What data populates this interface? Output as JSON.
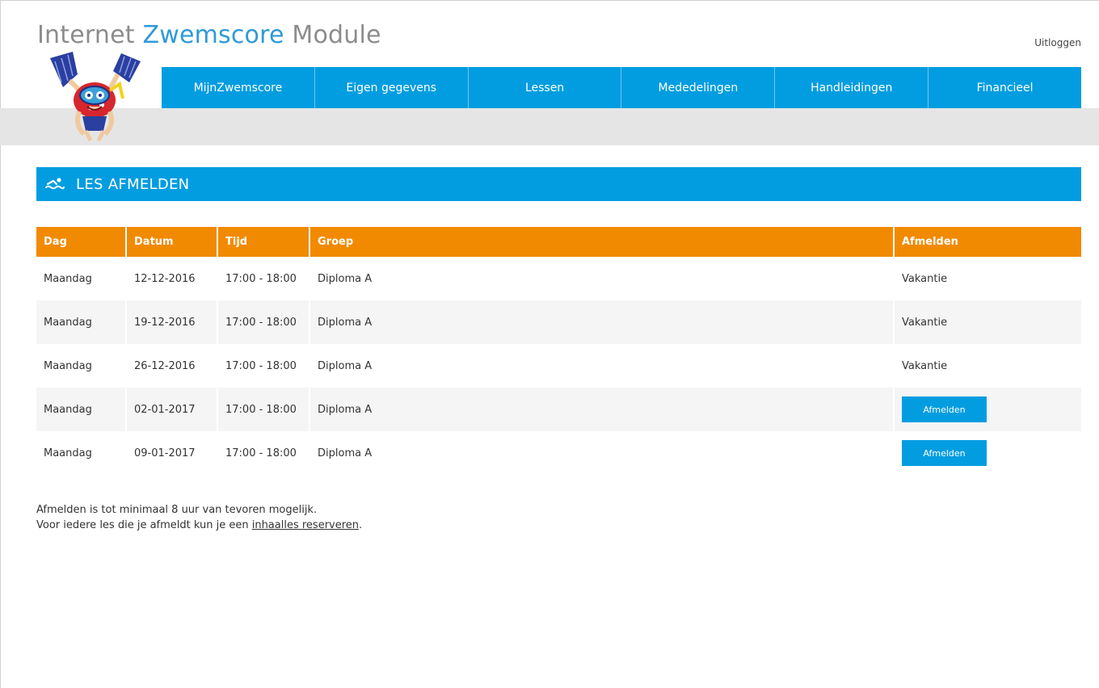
{
  "header": {
    "title_part1": "Internet ",
    "title_accent": "Zwemscore",
    "title_part2": " Module",
    "logout_label": "Uitloggen"
  },
  "nav": {
    "items": [
      {
        "label": "MijnZwemscore"
      },
      {
        "label": "Eigen gegevens"
      },
      {
        "label": "Lessen"
      },
      {
        "label": "Mededelingen"
      },
      {
        "label": "Handleidingen"
      },
      {
        "label": "Financieel"
      }
    ]
  },
  "section": {
    "icon": "swimmer-icon",
    "title": "LES AFMELDEN"
  },
  "table": {
    "headers": {
      "dag": "Dag",
      "datum": "Datum",
      "tijd": "Tijd",
      "groep": "Groep",
      "afmelden": "Afmelden"
    },
    "rows": [
      {
        "dag": "Maandag",
        "datum": "12-12-2016",
        "tijd": "17:00 - 18:00",
        "groep": "Diploma A",
        "status": "Vakantie"
      },
      {
        "dag": "Maandag",
        "datum": "19-12-2016",
        "tijd": "17:00 - 18:00",
        "groep": "Diploma A",
        "status": "Vakantie"
      },
      {
        "dag": "Maandag",
        "datum": "26-12-2016",
        "tijd": "17:00 - 18:00",
        "groep": "Diploma A",
        "status": "Vakantie"
      },
      {
        "dag": "Maandag",
        "datum": "02-01-2017",
        "tijd": "17:00 - 18:00",
        "groep": "Diploma A",
        "button": "Afmelden"
      },
      {
        "dag": "Maandag",
        "datum": "09-01-2017",
        "tijd": "17:00 - 18:00",
        "groep": "Diploma A",
        "button": "Afmelden"
      }
    ]
  },
  "notes": {
    "line1": "Afmelden is tot minimaal 8 uur van tevoren mogelijk.",
    "line2_prefix": "Voor iedere les die je afmeldt kun je een ",
    "line2_link": "inhaalles reserveren",
    "line2_suffix": "."
  },
  "colors": {
    "primary_blue": "#029de0",
    "header_orange": "#f18a00",
    "title_grey": "#8c8c8c",
    "title_accent_blue": "#2e9ad8"
  }
}
